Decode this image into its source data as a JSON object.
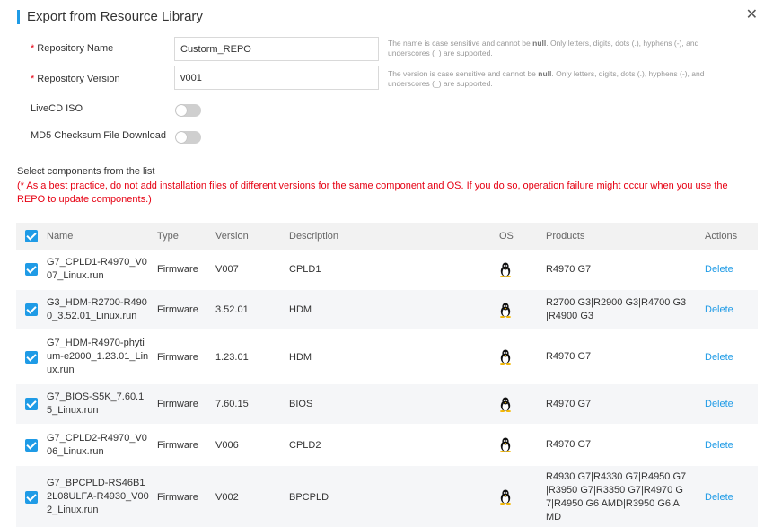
{
  "dialog": {
    "title": "Export from Resource Library",
    "close_icon": "close-icon"
  },
  "form": {
    "repo_name": {
      "required_mark": "*",
      "label": "Repository Name",
      "value": "Custorm_REPO",
      "hint_before": "The name is case sensitive and cannot be ",
      "hint_bold": "null",
      "hint_after": ". Only letters, digits, dots (.), hyphens (-), and underscores (_) are supported."
    },
    "repo_version": {
      "required_mark": "*",
      "label": "Repository Version",
      "value": "v001",
      "hint_before": "The version is case sensitive and cannot be ",
      "hint_bold": "null",
      "hint_after": ". Only letters, digits, dots (.), hyphens (-), and underscores (_) are supported."
    },
    "livecd": {
      "label": "LiveCD ISO",
      "enabled": false
    },
    "md5": {
      "label": "MD5 Checksum File Download",
      "enabled": false
    }
  },
  "components": {
    "section_title": "Select components from the list",
    "warning": "(* As a best practice, do not add installation files of different versions for the same component and OS. If you do so, operation failure might occur when you use the REPO to update components.)",
    "columns": {
      "name": "Name",
      "type": "Type",
      "version": "Version",
      "description": "Description",
      "os": "OS",
      "products": "Products",
      "actions": "Actions"
    },
    "rows": [
      {
        "name": "G7_CPLD1-R4970_V007_Linux.run",
        "type": "Firmware",
        "version": "V007",
        "description": "CPLD1",
        "os": "linux-icon",
        "products": "R4970 G7",
        "action": "Delete"
      },
      {
        "name": "G3_HDM-R2700-R4900_3.52.01_Linux.run",
        "type": "Firmware",
        "version": "3.52.01",
        "description": "HDM",
        "os": "linux-icon",
        "products": "R2700 G3|R2900 G3|R4700 G3|R4900 G3",
        "action": "Delete"
      },
      {
        "name": "G7_HDM-R4970-phytium-e2000_1.23.01_Linux.run",
        "type": "Firmware",
        "version": "1.23.01",
        "description": "HDM",
        "os": "linux-icon",
        "products": "R4970 G7",
        "action": "Delete"
      },
      {
        "name": "G7_BIOS-S5K_7.60.15_Linux.run",
        "type": "Firmware",
        "version": "7.60.15",
        "description": "BIOS",
        "os": "linux-icon",
        "products": "R4970 G7",
        "action": "Delete"
      },
      {
        "name": "G7_CPLD2-R4970_V006_Linux.run",
        "type": "Firmware",
        "version": "V006",
        "description": "CPLD2",
        "os": "linux-icon",
        "products": "R4970 G7",
        "action": "Delete"
      },
      {
        "name": "G7_BPCPLD-RS46B12L08ULFA-R4930_V002_Linux.run",
        "type": "Firmware",
        "version": "V002",
        "description": "BPCPLD",
        "os": "linux-icon",
        "products": "R4930 G7|R4330 G7|R4950 G7|R3950 G7|R3350 G7|R4970 G7|R4950 G6 AMD|R3950 G6 AMD",
        "action": "Delete"
      }
    ]
  },
  "colors": {
    "accent": "#1f9be6",
    "required": "#e60012",
    "warning": "#e60012"
  }
}
